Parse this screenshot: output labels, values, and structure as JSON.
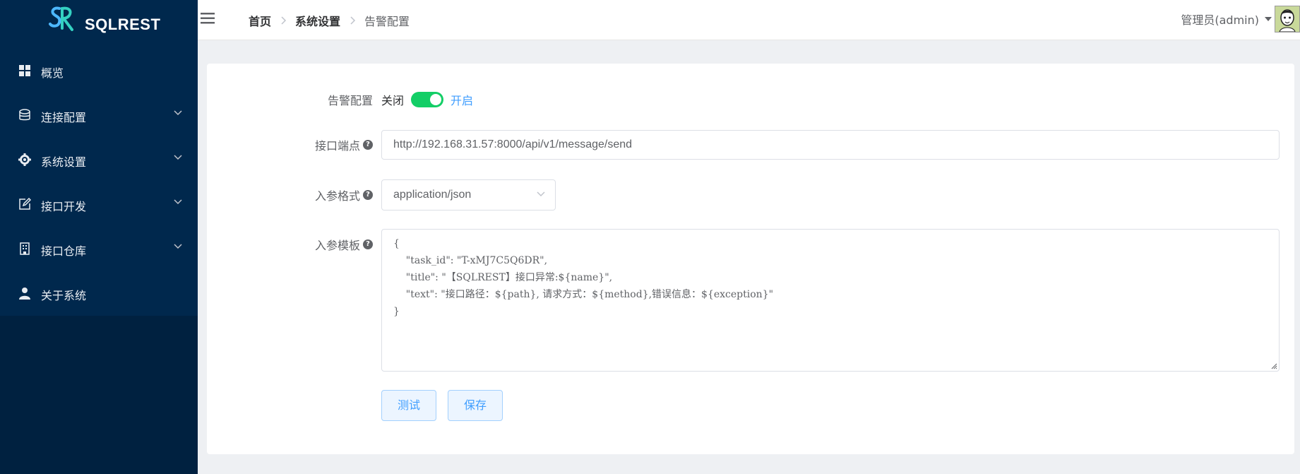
{
  "app": {
    "logo_text": "SQLREST"
  },
  "sidebar": {
    "items": [
      {
        "label": "概览",
        "icon": "grid-icon",
        "expandable": false
      },
      {
        "label": "连接配置",
        "icon": "database-icon",
        "expandable": true
      },
      {
        "label": "系统设置",
        "icon": "gear-icon",
        "expandable": true
      },
      {
        "label": "接口开发",
        "icon": "edit-icon",
        "expandable": true
      },
      {
        "label": "接口仓库",
        "icon": "building-icon",
        "expandable": true
      },
      {
        "label": "关于系统",
        "icon": "user-icon",
        "expandable": false
      }
    ]
  },
  "header": {
    "breadcrumb": [
      "首页",
      "系统设置",
      "告警配置"
    ],
    "user": "管理员(admin)"
  },
  "form": {
    "alert_label": "告警配置",
    "switch_off": "关闭",
    "switch_on": "开启",
    "switch_state": "on",
    "endpoint_label": "接口端点",
    "endpoint_value": "http://192.168.31.57:8000/api/v1/message/send",
    "format_label": "入参格式",
    "format_value": "application/json",
    "template_label": "入参模板",
    "template_value": "{\n    \"task_id\": \"T-xMJ7C5Q6DR\",\n    \"title\": \"【SQLREST】接口异常:${name}\",\n    \"text\": \"接口路径：${path}, 请求方式：${method},错误信息：${exception}\"\n}",
    "test_button": "测试",
    "save_button": "保存"
  },
  "colors": {
    "sidebar": "#002140",
    "accent": "#409eff",
    "switch_on": "#13ce66"
  }
}
